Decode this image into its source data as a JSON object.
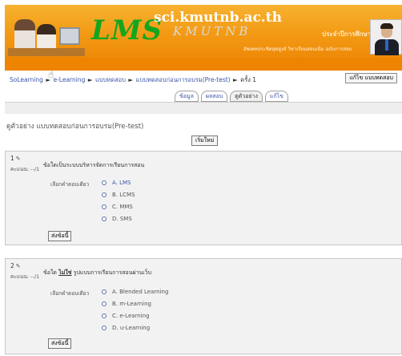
{
  "banner": {
    "logo": "LMS",
    "domain": "sci.kmutnb.ac.th",
    "script_text": "KMUTNB",
    "tag": "ประจำปีการศึกษา",
    "subtitle": "อัพเดทประชิตสุดสูงส์ วิชาเรียนสอนเนิ่ม ฉบับการสอบ",
    "colors": {
      "accent": "#f39a14",
      "logo": "#14a51e",
      "bar": "#ee8400"
    }
  },
  "nav": {
    "breadcrumb": [
      "SoLearning",
      "e-Learning",
      "แบบทดสอบ",
      "แบบทดสอบก่อนการอบรม(Pre-test)",
      "ครั้ง 1"
    ],
    "separator": "►",
    "edit_button": "แก้ไข แบบทดสอบ"
  },
  "tabs": [
    {
      "label": "ข้อมูล",
      "active": false
    },
    {
      "label": "ผลสอบ",
      "active": false
    },
    {
      "label": "ดูตัวอย่าง",
      "active": true
    },
    {
      "label": "แก้ไข",
      "active": false
    }
  ],
  "page": {
    "title": "ดูตัวอย่าง แบบทดสอบก่อนการอบรม(Pre-test)",
    "restart_button": "เริ่มใหม่"
  },
  "questions": [
    {
      "number": "1",
      "score": "คะแนน: --/1",
      "text_before": "ข้อใดเป็นระบบบริหารจัดการเรียนการสอน",
      "text_emphasis": "",
      "text_after": "",
      "choose_label": "เลือกคำตอบเดียว",
      "options": [
        "A. LMS",
        "B. LCMS",
        "C. MMS",
        "D. SMS"
      ],
      "submit": "ส่งข้อนี้"
    },
    {
      "number": "2",
      "score": "คะแนน: --/1",
      "text_before": "ข้อใด ",
      "text_emphasis": "ไม่ใช่",
      "text_after": " รูปแบบการเรียนการสอนผ่านเว็บ",
      "choose_label": "เลือกคำตอบเดียว",
      "options": [
        "A. Blended Learning",
        "B. m-Learning",
        "C. e-Learning",
        "D. u-Learning"
      ],
      "submit": "ส่งข้อนี้"
    }
  ]
}
